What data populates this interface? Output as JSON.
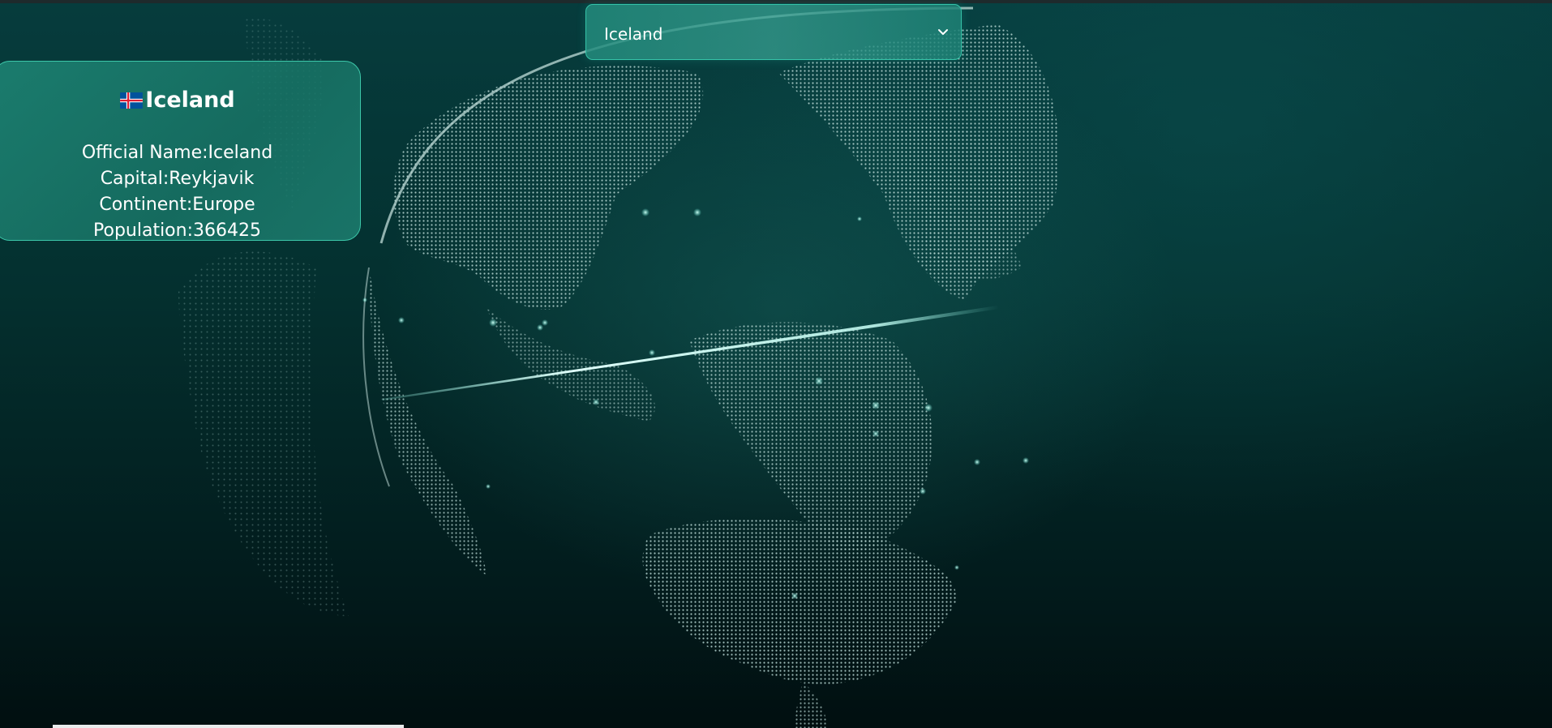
{
  "selector": {
    "selected": "Iceland",
    "icon": "chevron-down-icon"
  },
  "country_card": {
    "flag_icon": "iceland-flag-icon",
    "name": "Iceland",
    "official_name_label": "Official Name:",
    "official_name": "Iceland",
    "capital_label": "Capital:",
    "capital": "Reykjavik",
    "continent_label": "Continent:",
    "continent": "Europe",
    "population_label": "Population:",
    "population": "366425"
  },
  "colors": {
    "accent_border": "#35c3a8",
    "card_fill": "#1e8776",
    "background": "#04302f",
    "text": "#ffffff"
  }
}
